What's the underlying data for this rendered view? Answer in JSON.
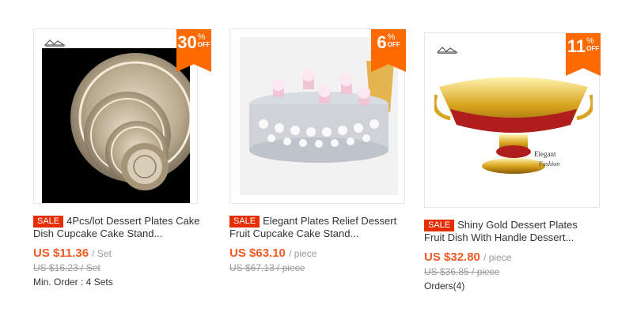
{
  "products": [
    {
      "discount_num": "30",
      "discount_pct": "%",
      "discount_off": "OFF",
      "sale_badge": "SALE",
      "title_line1": "4Pcs/lot Dessert Plates Cake",
      "title_line2": "Dish Cupcake Cake Stand...",
      "price": "US $11.36",
      "unit": "/ Set",
      "old_price": "US $16.23 / Set",
      "extra": "Min. Order : 4 Sets"
    },
    {
      "discount_num": "6",
      "discount_pct": "%",
      "discount_off": "OFF",
      "sale_badge": "SALE",
      "title_line1": "Elegant Plates Relief Dessert",
      "title_line2": "Fruit Cupcake Cake Stand...",
      "price": "US $63.10",
      "unit": "/ piece",
      "old_price": "US $67.13 / piece",
      "extra": ""
    },
    {
      "discount_num": "11",
      "discount_pct": "%",
      "discount_off": "OFF",
      "sale_badge": "SALE",
      "title_line1": "Shiny Gold Dessert Plates",
      "title_line2": "Fruit Dish With Handle Dessert...",
      "price": "US $32.80",
      "unit": "/ piece",
      "old_price": "US $36.85 / piece",
      "extra": "Orders(4)",
      "photo_caption_1": "Elegant",
      "photo_caption_2": "Fashion"
    }
  ],
  "colors": {
    "badge": "#ff6a00",
    "sale": "#e62e04",
    "price": "#f05a24"
  }
}
